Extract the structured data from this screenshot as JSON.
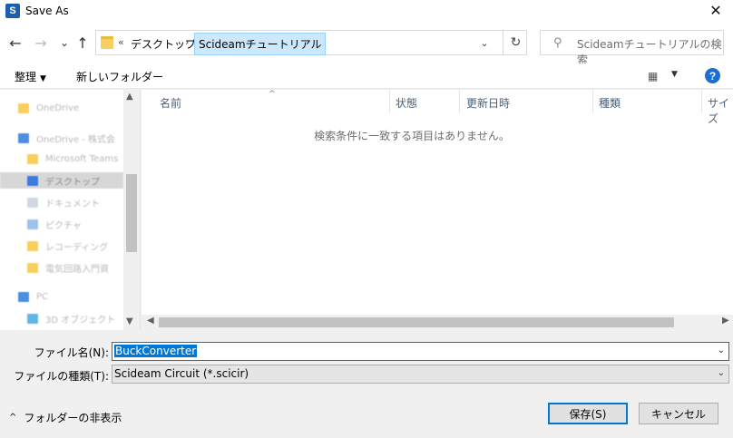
{
  "window": {
    "title": "Save As",
    "app_icon_letter": "S",
    "close_label": "✕"
  },
  "nav": {
    "back": "←",
    "forward": "→",
    "recent": "⌄",
    "up": "↑",
    "breadcrumb_prefix": "«",
    "breadcrumb": [
      "デスクトップ",
      "Scideamチュートリアル"
    ],
    "breadcrumb_sep": "›",
    "dropdown": "⌄",
    "refresh": "↻",
    "search_placeholder": "Scideamチュートリアルの検索",
    "search_icon": "⚲"
  },
  "toolbar": {
    "organize_label": "整理",
    "new_folder_label": "新しいフォルダー",
    "view_icon": "▦",
    "help_label": "?"
  },
  "sidebar": {
    "items": [
      {
        "label": "OneDrive",
        "icon_color": "#f6cf5e"
      },
      {
        "label": "OneDrive - 株式会",
        "icon_color": "#4a8fe0"
      },
      {
        "label": "Microsoft Teams",
        "icon_color": "#f6cf5e"
      },
      {
        "label": "デスクトップ",
        "icon_color": "#3b7be0",
        "selected": true
      },
      {
        "label": "ドキュメント",
        "icon_color": "#cfd8e4"
      },
      {
        "label": "ピクチャ",
        "icon_color": "#9ec3e8"
      },
      {
        "label": "レコーディング",
        "icon_color": "#f6cf5e"
      },
      {
        "label": "電気回路入門資",
        "icon_color": "#f6cf5e"
      },
      {
        "label": "PC",
        "icon_color": "#4a8fe0"
      },
      {
        "label": "3D オブジェクト",
        "icon_color": "#61b6e8"
      }
    ]
  },
  "file_list": {
    "columns": [
      "名前",
      "状態",
      "更新日時",
      "種類",
      "サイズ"
    ],
    "sort_indicator": "^",
    "empty_message": "検索条件に一致する項目はありません。"
  },
  "form": {
    "filename_label": "ファイル名(N):",
    "filename_value": "BuckConverter",
    "filetype_label": "ファイルの種類(T):",
    "filetype_value": "Scideam Circuit (*.scicir)",
    "dropdown": "⌄"
  },
  "footer": {
    "hide_folders_label": "フォルダーの非表示",
    "chevron": "^",
    "save_label": "保存(S)",
    "cancel_label": "キャンセル"
  }
}
